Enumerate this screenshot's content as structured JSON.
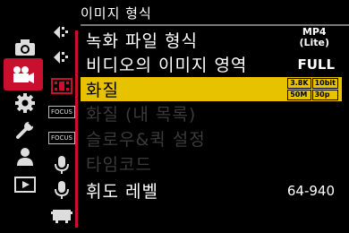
{
  "header": {
    "title": "이미지 형식"
  },
  "menu": {
    "items": [
      {
        "label": "녹화 파일 형식",
        "value_line1": "MP4",
        "value_line2": "(Lite)"
      },
      {
        "label": "비디오의 이미지 영역",
        "value": "FULL"
      },
      {
        "label": "화질",
        "badges": [
          "3.8K",
          "10bit",
          "50M",
          "30p"
        ]
      },
      {
        "label": "화질 (내 목록)"
      },
      {
        "label": "슬로우&퀵 설정"
      },
      {
        "label": "타임코드"
      },
      {
        "label": "휘도 레벨",
        "value": "64-940"
      }
    ]
  },
  "sub_tabs": {
    "focus_label": "FOCUS"
  },
  "colors": {
    "accent_red": "#c8102e",
    "highlight_yellow": "#e6c200",
    "dim_text": "#3a3a3a"
  }
}
